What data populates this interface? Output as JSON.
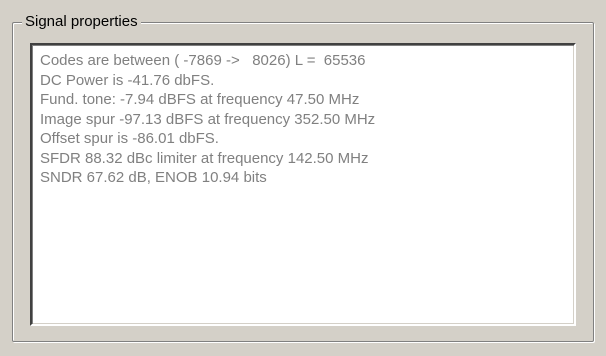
{
  "window": {
    "background_color": "#d4d0c8"
  },
  "group": {
    "title": "Signal properties"
  },
  "text_area": {
    "text_color": "#808080",
    "lines": [
      "Codes are between ( -7869 ->   8026) L =  65536",
      "DC Power is -41.76 dbFS.",
      "Fund. tone: -7.94 dBFS at frequency 47.50 MHz",
      "Image spur -97.13 dBFS at frequency 352.50 MHz",
      "Offset spur is -86.01 dbFS.",
      "SFDR 88.32 dBc limiter at frequency 142.50 MHz",
      "SNDR 67.62 dB, ENOB 10.94 bits"
    ]
  }
}
